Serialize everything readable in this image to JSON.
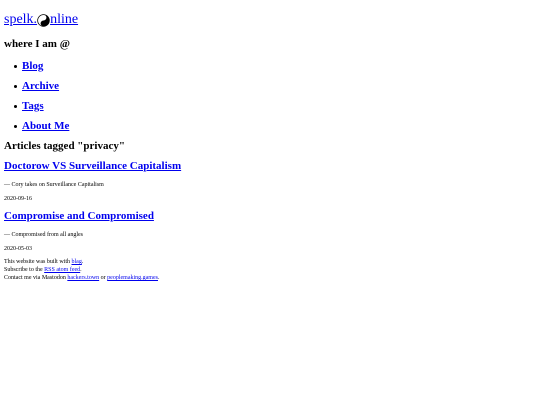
{
  "site": {
    "title_prefix": "spelk.",
    "title_suffix": "nline",
    "logo_icon": "yin-yang-icon",
    "tagline": "where I am @"
  },
  "nav": [
    {
      "label": "Blog"
    },
    {
      "label": "Archive"
    },
    {
      "label": "Tags"
    },
    {
      "label": "About Me"
    }
  ],
  "section_title": "Articles tagged \"privacy\"",
  "articles": [
    {
      "title": "Doctorow VS Surveillance Capitalism",
      "subtitle": "— Cory takes on Surveillance Capitalism",
      "date": "2020-09-16"
    },
    {
      "title": "Compromise and Compromised",
      "subtitle": "— Compromised from all angles",
      "date": "2020-05-03"
    }
  ],
  "footer": {
    "line1_prefix": "This website was built with ",
    "line1_link": "blag",
    "line1_suffix": ".",
    "line2_prefix": "Subscribe to the ",
    "line2_link": "RSS atom feed",
    "line2_suffix": ".",
    "line3_prefix": "Contact me via Mastodon ",
    "line3_link1": "hackers.town",
    "line3_mid": " or ",
    "line3_link2": "peoplemaking.games",
    "line3_suffix": "."
  },
  "colors": {
    "link": "#0000ee",
    "text": "#000000",
    "background": "#ffffff"
  }
}
